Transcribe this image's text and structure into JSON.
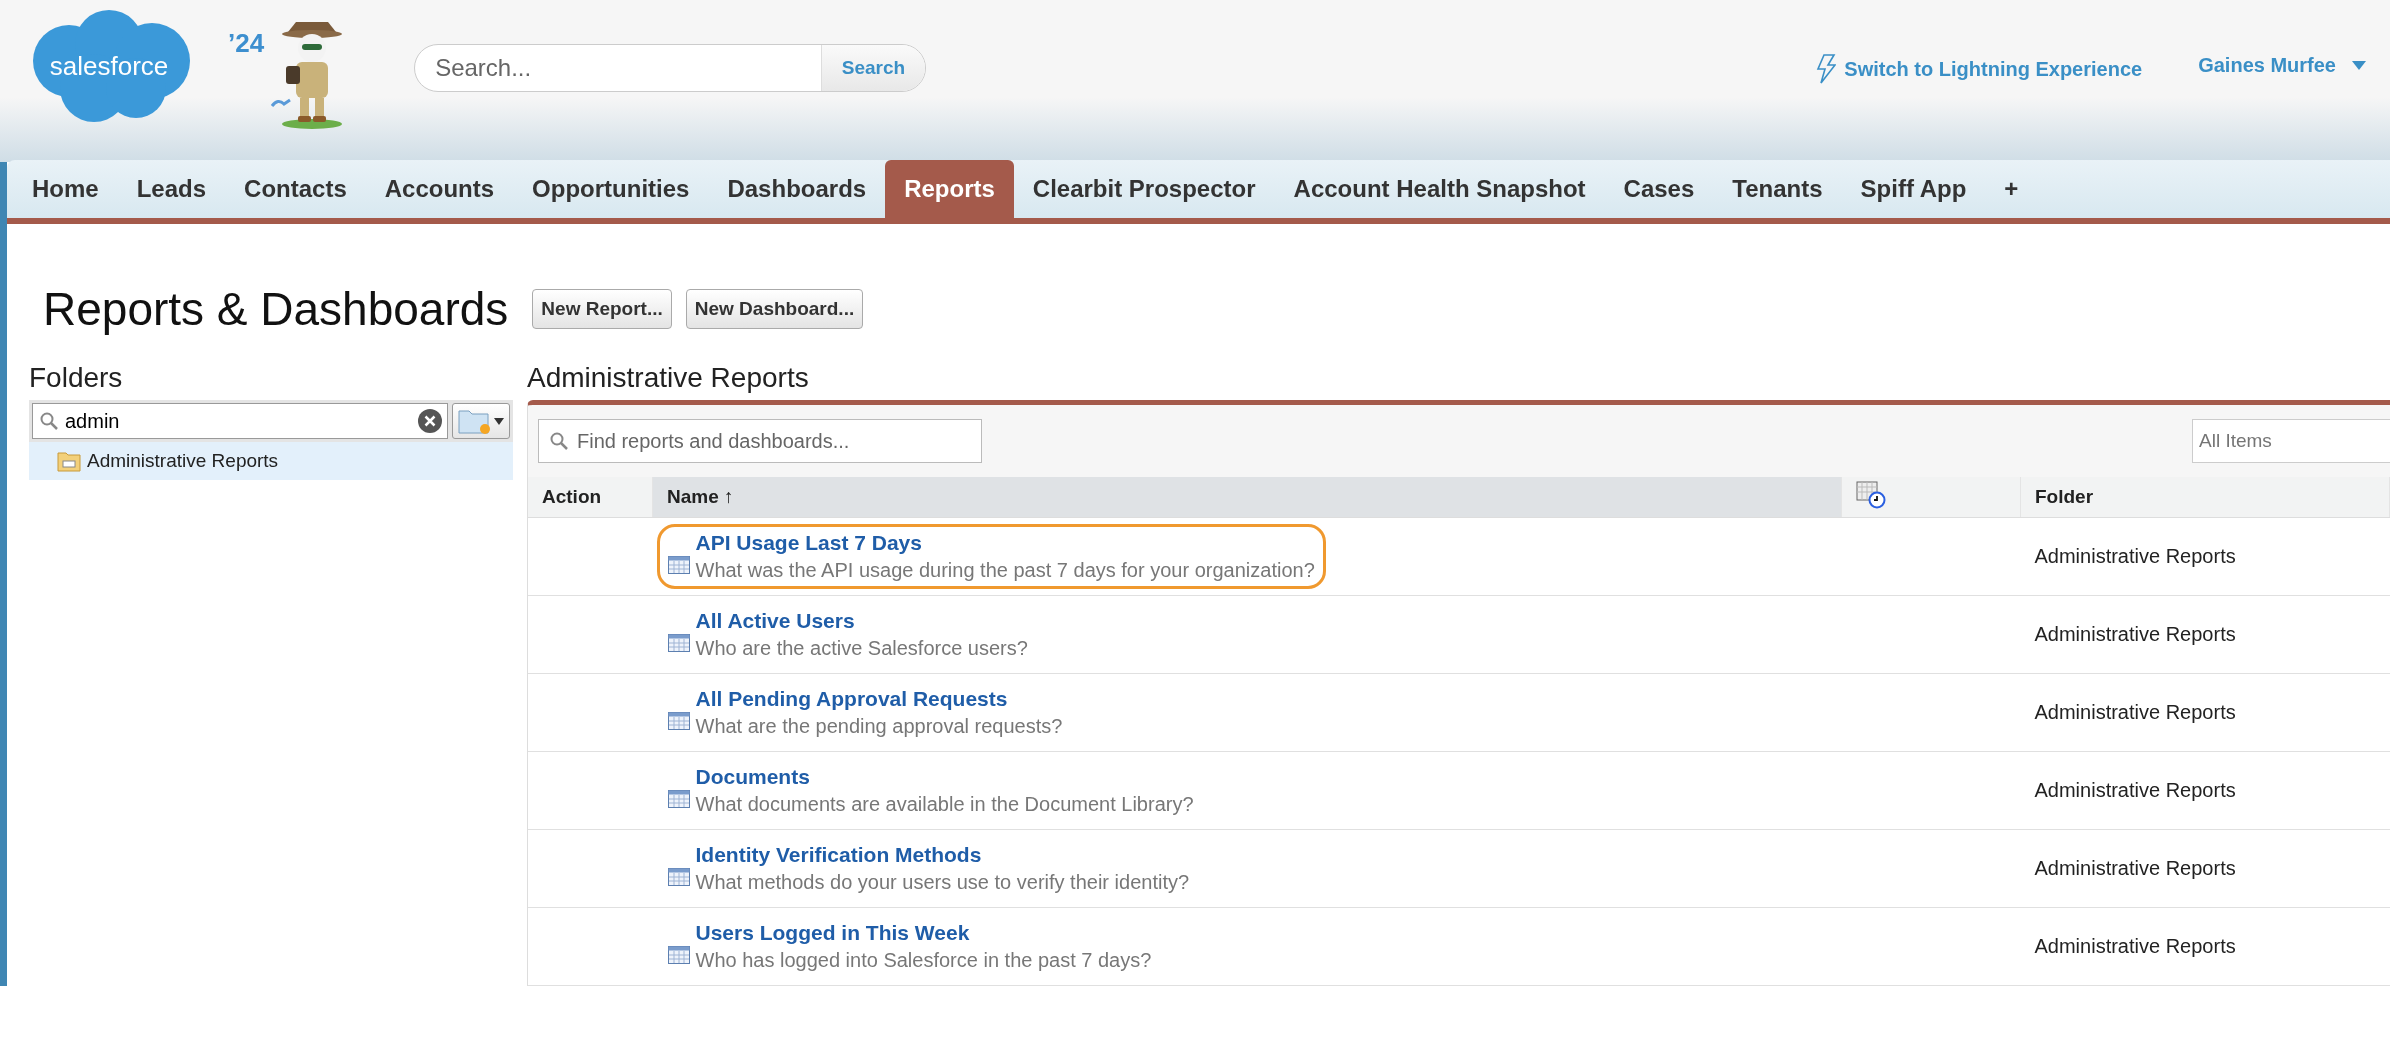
{
  "header": {
    "logo": "salesforce",
    "badge": "’24",
    "search": {
      "placeholder": "Search...",
      "button": "Search"
    },
    "switch_link": "Switch to Lightning Experience",
    "user": "Gaines Murfee"
  },
  "tabs": [
    {
      "label": "Home",
      "selected": false
    },
    {
      "label": "Leads",
      "selected": false
    },
    {
      "label": "Contacts",
      "selected": false
    },
    {
      "label": "Accounts",
      "selected": false
    },
    {
      "label": "Opportunities",
      "selected": false
    },
    {
      "label": "Dashboards",
      "selected": false
    },
    {
      "label": "Reports",
      "selected": true
    },
    {
      "label": "Clearbit Prospector",
      "selected": false
    },
    {
      "label": "Account Health Snapshot",
      "selected": false
    },
    {
      "label": "Cases",
      "selected": false
    },
    {
      "label": "Tenants",
      "selected": false
    },
    {
      "label": "Spiff App",
      "selected": false
    },
    {
      "label": "+",
      "selected": false
    }
  ],
  "page": {
    "title": "Reports & Dashboards",
    "buttons": [
      "New Report...",
      "New Dashboard..."
    ]
  },
  "folders": {
    "title": "Folders",
    "search_value": "admin",
    "items": [
      {
        "label": "Administrative Reports",
        "selected": true
      }
    ]
  },
  "list": {
    "title": "Administrative Reports",
    "search": {
      "placeholder": "Find reports and dashboards..."
    },
    "filter": {
      "placeholder": "All Items"
    },
    "columns": [
      "Action",
      "Name ↑",
      "Folder"
    ],
    "rows": [
      {
        "name": "API Usage Last 7 Days",
        "description": "What was the API usage during the past 7 days for your organization?",
        "folder": "Administrative Reports",
        "highlighted": true
      },
      {
        "name": "All Active Users",
        "description": "Who are the active Salesforce users?",
        "folder": "Administrative Reports",
        "highlighted": false
      },
      {
        "name": "All Pending Approval Requests",
        "description": "What are the pending approval requests?",
        "folder": "Administrative Reports",
        "highlighted": false
      },
      {
        "name": "Documents",
        "description": "What documents are available in the Document Library?",
        "folder": "Administrative Reports",
        "highlighted": false
      },
      {
        "name": "Identity Verification Methods",
        "description": "What methods do your users use to verify their identity?",
        "folder": "Administrative Reports",
        "highlighted": false
      },
      {
        "name": "Users Logged in This Week",
        "description": "Who has logged into Salesforce in the past 7 days?",
        "folder": "Administrative Reports",
        "highlighted": false
      }
    ]
  }
}
